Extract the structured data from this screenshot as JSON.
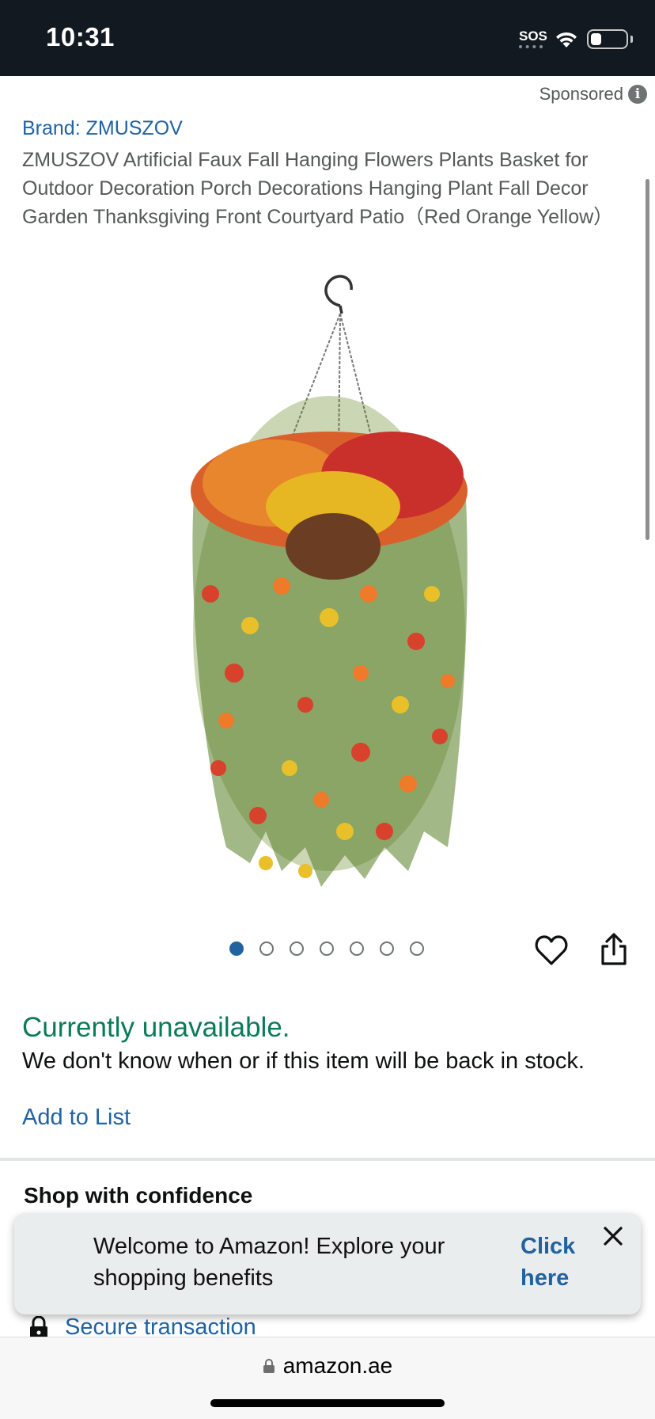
{
  "status_bar": {
    "time": "10:31",
    "sos": "SOS",
    "battery_level": 0.3
  },
  "sponsored": {
    "label": "Sponsored",
    "info_glyph": "i"
  },
  "product": {
    "brand": "Brand: ZMUSZOV",
    "title": "ZMUSZOV Artificial Faux Fall Hanging Flowers Plants Basket for Outdoor Decoration Porch Decorations Hanging Plant Fall Decor Garden Thanksgiving Front Courtyard Patio（Red Orange Yellow）",
    "image_count": 7,
    "active_image_index": 0
  },
  "availability": {
    "status": "Currently unavailable.",
    "note": "We don't know when or if this item will be back in stock."
  },
  "actions": {
    "add_to_list": "Add to List"
  },
  "confidence": {
    "heading": "Shop with confidence",
    "secure_transaction": "Secure transaction"
  },
  "toast": {
    "message": "Welcome to Amazon! Explore your shopping benefits",
    "link": "Click here"
  },
  "browser": {
    "url": "amazon.ae"
  },
  "colors": {
    "header_bg": "#131921",
    "link": "#2162a1",
    "availability": "#0b7a5a"
  },
  "icons": [
    "wifi-icon",
    "battery-icon",
    "info-icon",
    "heart-icon",
    "share-icon",
    "lock-icon",
    "close-icon"
  ]
}
